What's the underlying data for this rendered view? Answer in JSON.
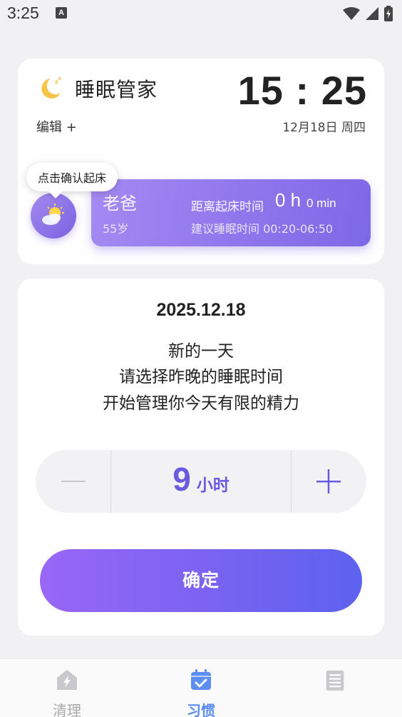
{
  "status_bar": {
    "time": "3:25",
    "notification_badge": "A"
  },
  "header": {
    "app_title": "睡眠管家",
    "clock": "15 : 25",
    "edit_label": "编辑 +",
    "date": "12月18日 周四"
  },
  "tooltip": "点击确认起床",
  "member": {
    "name": "老爸",
    "age": "55岁",
    "wake_label": "距离起床时间",
    "wake_hours": "0 h",
    "wake_minutes": "0 min",
    "suggest": "建议睡眠时间 00:20-06:50"
  },
  "main": {
    "date": "2025.12.18",
    "message_line1": "新的一天",
    "message_line2": "请选择昨晚的睡眠时间",
    "message_line3": "开始管理你今天有限的精力",
    "hours_value": "9",
    "hours_unit": "小时",
    "confirm_label": "确定"
  },
  "bottom_nav": {
    "items": [
      {
        "label": "清理",
        "icon": "house-bolt-icon",
        "active": false
      },
      {
        "label": "习惯",
        "icon": "calendar-check-icon",
        "active": true
      },
      {
        "label": "",
        "icon": "document-icon",
        "active": false
      }
    ]
  },
  "colors": {
    "accent": "#6a5ae0",
    "nav_active": "#5b8df2",
    "card_gradient_start": "#a48af2",
    "button_gradient_end": "#5d62ef"
  }
}
